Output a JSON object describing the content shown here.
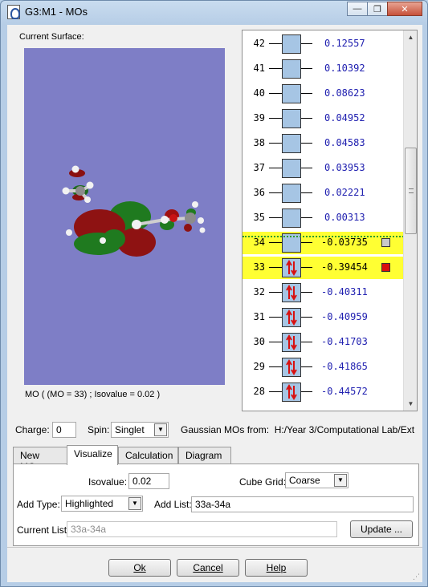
{
  "window": {
    "title": "G3:M1 - MOs",
    "minimize_glyph": "—",
    "restore_glyph": "❐",
    "close_glyph": "✕"
  },
  "surface": {
    "label": "Current Surface:",
    "caption": "MO ( (MO = 33) ; Isovalue = 0.02 )",
    "background_color": "#7e7ec6"
  },
  "mo_list": {
    "rows": [
      {
        "num": "42",
        "energy": "0.12557",
        "occupied": false
      },
      {
        "num": "41",
        "energy": "0.10392",
        "occupied": false
      },
      {
        "num": "40",
        "energy": "0.08623",
        "occupied": false
      },
      {
        "num": "39",
        "energy": "0.04952",
        "occupied": false
      },
      {
        "num": "38",
        "energy": "0.04583",
        "occupied": false
      },
      {
        "num": "37",
        "energy": "0.03953",
        "occupied": false
      },
      {
        "num": "36",
        "energy": "0.02221",
        "occupied": false
      },
      {
        "num": "35",
        "energy": "0.00313",
        "occupied": false
      },
      {
        "num": "34",
        "energy": "-0.03735",
        "occupied": false,
        "highlighted": true,
        "marker": "grey"
      },
      {
        "num": "33",
        "energy": "-0.39454",
        "occupied": true,
        "highlighted": true,
        "marker": "red"
      },
      {
        "num": "32",
        "energy": "-0.40311",
        "occupied": true
      },
      {
        "num": "31",
        "energy": "-0.40959",
        "occupied": true
      },
      {
        "num": "30",
        "energy": "-0.41703",
        "occupied": true
      },
      {
        "num": "29",
        "energy": "-0.41865",
        "occupied": true
      },
      {
        "num": "28",
        "energy": "-0.44572",
        "occupied": true
      }
    ],
    "highlight_color": "#ffff33",
    "homo_lumo_divider_color": "#2c9c2c"
  },
  "options": {
    "charge_label": "Charge:",
    "charge_value": "0",
    "spin_label": "Spin:",
    "spin_value": "Singlet",
    "source_label": "Gaussian MOs from:",
    "source_path": "H:/Year 3/Computational Lab/Ext"
  },
  "tabs": [
    {
      "label": "New MOs",
      "active": false
    },
    {
      "label": "Visualize",
      "active": true
    },
    {
      "label": "Calculation",
      "active": false
    },
    {
      "label": "Diagram",
      "active": false
    }
  ],
  "visualize": {
    "isovalue_label": "Isovalue:",
    "isovalue_value": "0.02",
    "cube_grid_label": "Cube Grid:",
    "cube_grid_value": "Coarse",
    "add_type_label": "Add Type:",
    "add_type_value": "Highlighted",
    "add_list_label": "Add List:",
    "add_list_value": "33a-34a",
    "current_list_label": "Current List:",
    "current_list_value": "33a-34a",
    "update_label": "Update ..."
  },
  "buttons": {
    "ok_label": "Ok",
    "cancel_label": "Cancel",
    "help_label": "Help"
  }
}
